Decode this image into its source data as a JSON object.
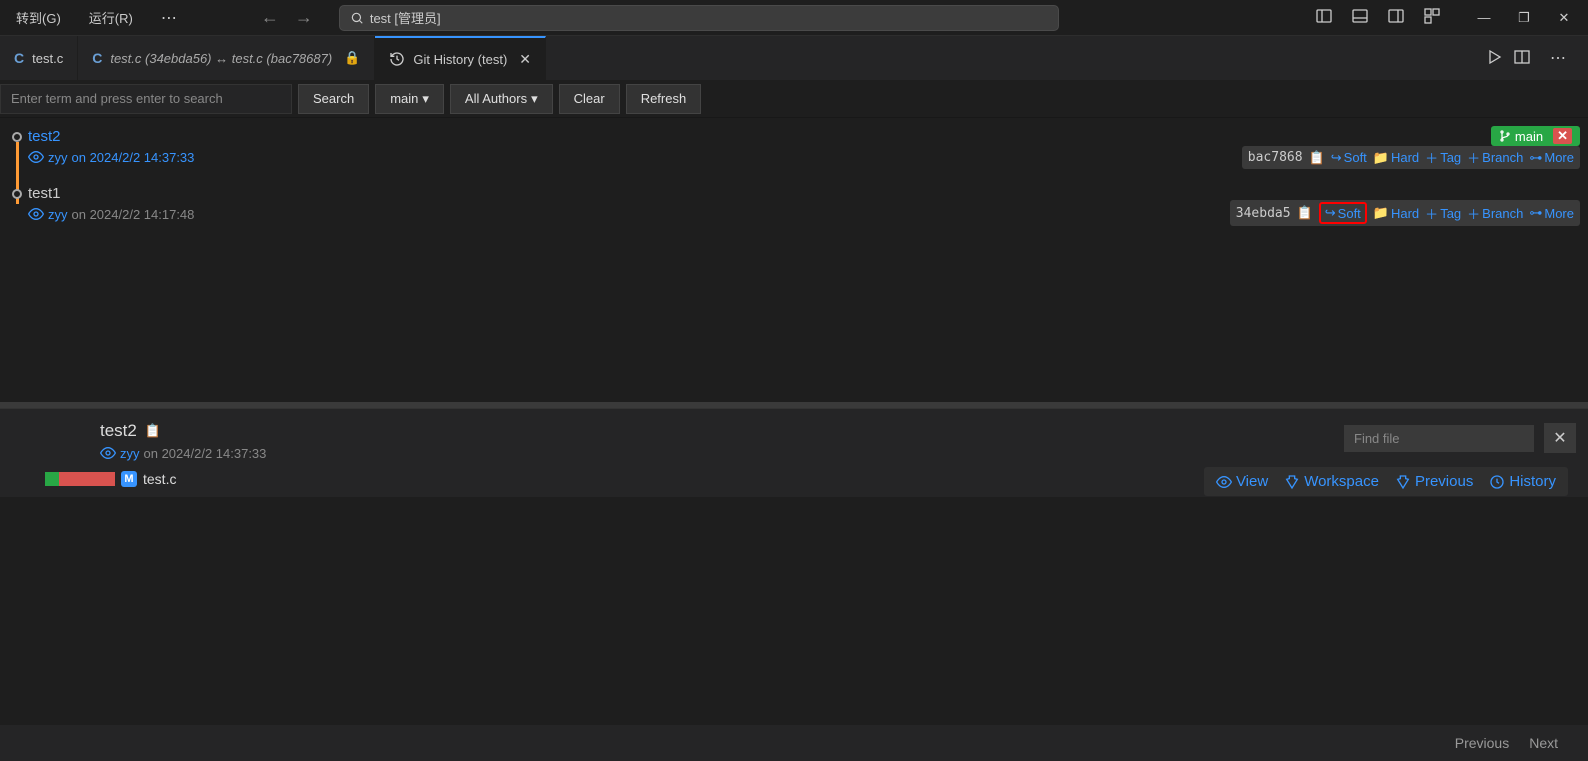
{
  "menu": {
    "goto": "转到(G)",
    "run": "运行(R)"
  },
  "searchbar": {
    "text": "test [管理员]"
  },
  "tabs": {
    "t1": "test.c",
    "t2": "test.c (34ebda56) ↔ test.c (bac78687)",
    "t3": "Git History (test)"
  },
  "filter": {
    "placeholder": "Enter term and press enter to search",
    "search": "Search",
    "branch": "main",
    "authors": "All Authors",
    "clear": "Clear",
    "refresh": "Refresh"
  },
  "commits": [
    {
      "title": "test2",
      "author": "zyy",
      "date": "on 2024/2/2 14:37:33",
      "branch": "main",
      "hash": "bac7868",
      "active": true
    },
    {
      "title": "test1",
      "author": "zyy",
      "date": "on 2024/2/2 14:17:48",
      "hash": "34ebda5",
      "active": false
    }
  ],
  "actions": {
    "soft": "Soft",
    "hard": "Hard",
    "tag": "Tag",
    "branch": "Branch",
    "more": "More"
  },
  "detail": {
    "title": "test2",
    "author": "zyy",
    "date": "on 2024/2/2 14:37:33",
    "file": "test.c",
    "findPlaceholder": "Find file",
    "view": "View",
    "workspace": "Workspace",
    "previous": "Previous",
    "history": "History"
  },
  "footer": {
    "prev": "Previous",
    "next": "Next"
  }
}
